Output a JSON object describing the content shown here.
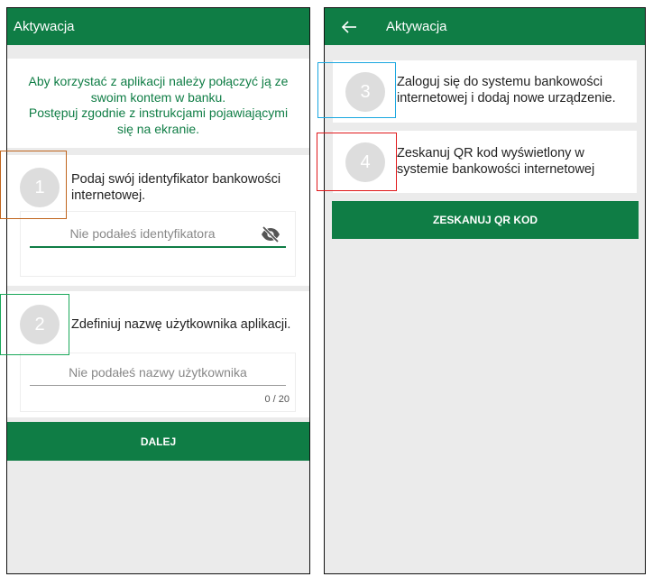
{
  "left_screen": {
    "title": "Aktywacja",
    "intro": {
      "line1": "Aby korzystać z aplikacji należy połączyć ją ze",
      "line2": "swoim kontem w banku.",
      "line3": "Postępuj zgodnie z instrukcjami pojawiającymi",
      "line4": "się na ekranie."
    },
    "step1": {
      "number": "1",
      "text": "Podaj swój identyfikator bankowości internetowej.",
      "placeholder": "Nie podałeś identyfikatora",
      "icon": "eye-slash-icon"
    },
    "step2": {
      "number": "2",
      "text": "Zdefiniuj nazwę użytkownika aplikacji.",
      "placeholder": "Nie podałeś nazwy użytkownika",
      "counter": "0 / 20"
    },
    "next_button": "DALEJ"
  },
  "right_screen": {
    "title": "Aktywacja",
    "back_icon": "arrow-left-icon",
    "step3": {
      "number": "3",
      "text": "Zaloguj się do systemu bankowości internetowej i dodaj nowe urządzenie."
    },
    "step4": {
      "number": "4",
      "text": "Zeskanuj QR kod wyświetlony w systemie bankowości internetowej"
    },
    "scan_button": "ZESKANUJ QR KOD"
  },
  "colors": {
    "brand_green": "#0f7d45",
    "highlight_orange": "#c0651d",
    "highlight_green": "#1aa85a",
    "highlight_blue": "#1aa7e0",
    "highlight_red": "#e0181b"
  }
}
